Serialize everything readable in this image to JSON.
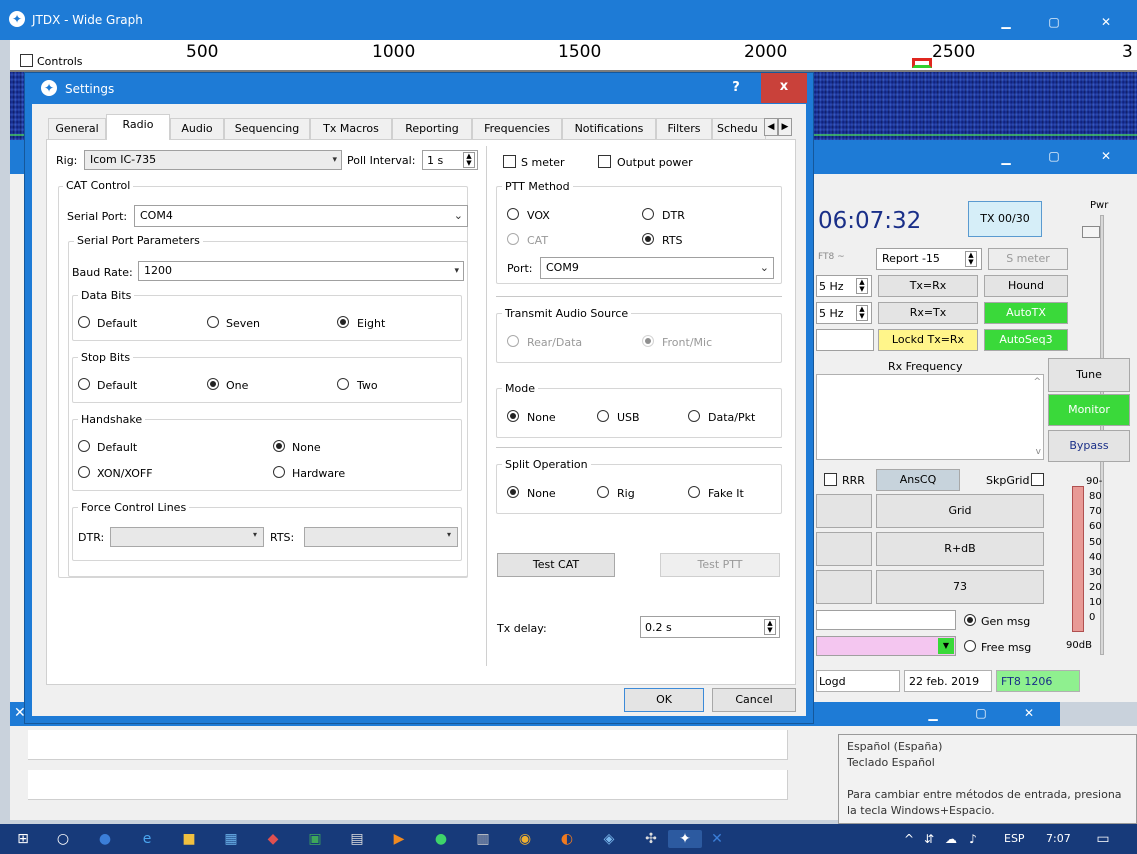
{
  "wide_graph": {
    "title": "JTDX - Wide Graph",
    "controls_label": "Controls",
    "freq_labels": [
      "500",
      "1000",
      "1500",
      "2000",
      "2500",
      "3"
    ]
  },
  "main": {
    "clock": "06:07:32",
    "tx_counter": "TX 00/30",
    "pwr_label": "Pwr",
    "ft8_label": "FT8 ~",
    "report": "Report -15",
    "smeter": "S meter",
    "hz1": "5  Hz",
    "hz2": "5  Hz",
    "tx_eq_rx": "Tx=Rx",
    "hound": "Hound",
    "rx_eq_tx": "Rx=Tx",
    "autotx": "AutoTX",
    "lockd": "Lockd Tx=Rx",
    "autoseq": "AutoSeq3",
    "rx_frequency": "Rx Frequency",
    "tune": "Tune",
    "monitor": "Monitor",
    "bypass": "Bypass",
    "rrr": "RRR",
    "anscq": "AnsCQ",
    "skpgrid": "SkpGrid",
    "grid": "Grid",
    "rdb": "R+dB",
    "seventythree": "73",
    "gen_msg": "Gen msg",
    "free_msg": "Free msg",
    "logd": "Logd",
    "date": "22 feb. 2019",
    "mode_freq": "FT8  1206",
    "scale": [
      "90-",
      "80",
      "70",
      "60",
      "50",
      "40",
      "30",
      "20",
      "10",
      "0"
    ],
    "scale_unit": "90dB"
  },
  "settings": {
    "title": "Settings",
    "help": "?",
    "close": "x",
    "tabs": [
      "General",
      "Radio",
      "Audio",
      "Sequencing",
      "Tx Macros",
      "Reporting",
      "Frequencies",
      "Notifications",
      "Filters",
      "Schedu"
    ],
    "rig_label": "Rig:",
    "rig_value": "Icom IC-735",
    "poll_label": "Poll Interval:",
    "poll_value": "1 s",
    "smeter": "S meter",
    "output_power": "Output power",
    "cat_control": "CAT Control",
    "serial_port_label": "Serial Port:",
    "serial_port_value": "COM4",
    "serial_params": "Serial Port Parameters",
    "baud_label": "Baud Rate:",
    "baud_value": "1200",
    "data_bits": "Data Bits",
    "db_default": "Default",
    "db_seven": "Seven",
    "db_eight": "Eight",
    "stop_bits": "Stop Bits",
    "sb_default": "Default",
    "sb_one": "One",
    "sb_two": "Two",
    "handshake": "Handshake",
    "hs_default": "Default",
    "hs_none": "None",
    "hs_xon": "XON/XOFF",
    "hs_hardware": "Hardware",
    "force_lines": "Force Control Lines",
    "dtr_label": "DTR:",
    "rts_label": "RTS:",
    "ptt_method": "PTT Method",
    "ptt_vox": "VOX",
    "ptt_dtr": "DTR",
    "ptt_cat": "CAT",
    "ptt_rts": "RTS",
    "port_label": "Port:",
    "port_value": "COM9",
    "tx_audio_source": "Transmit Audio Source",
    "rear_data": "Rear/Data",
    "front_mic": "Front/Mic",
    "mode": "Mode",
    "mode_none": "None",
    "mode_usb": "USB",
    "mode_data": "Data/Pkt",
    "split": "Split Operation",
    "split_none": "None",
    "split_rig": "Rig",
    "split_fake": "Fake It",
    "test_cat": "Test CAT",
    "test_ptt": "Test PTT",
    "tx_delay_label": "Tx delay:",
    "tx_delay_value": "0.2 s",
    "ok": "OK",
    "cancel": "Cancel"
  },
  "tooltip": {
    "lines": [
      "Español (España)",
      "Teclado Español",
      "",
      "Para cambiar entre métodos de entrada, presiona",
      "la tecla Windows+Espacio."
    ]
  },
  "taskbar": {
    "lang": "ESP",
    "time": "7:07"
  }
}
